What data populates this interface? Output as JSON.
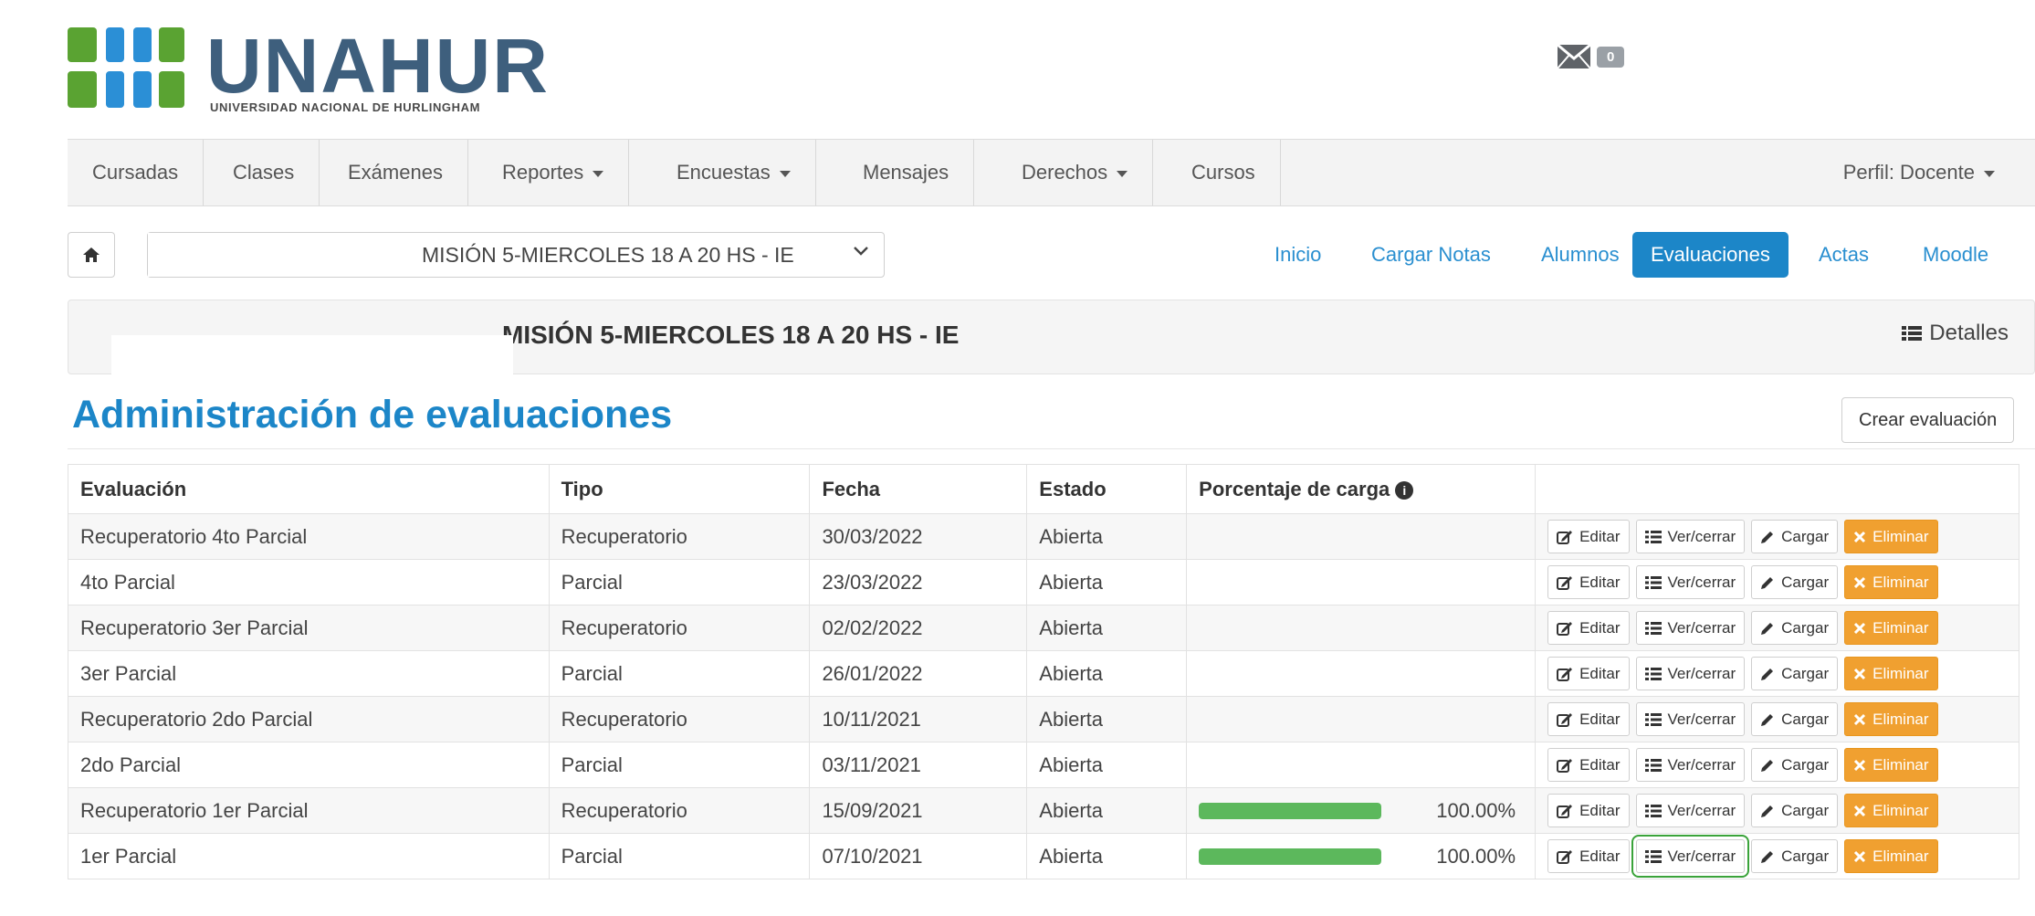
{
  "brand": {
    "title": "UNAHUR",
    "subtitle": "UNIVERSIDAD NACIONAL DE HURLINGHAM",
    "colors": {
      "green": "#5aa332",
      "blue": "#2b8fd6",
      "title": "#3e5f7d"
    }
  },
  "header": {
    "mail_icon": "envelope-icon",
    "unread_count": "0"
  },
  "nav": {
    "items": [
      {
        "label": "Cursadas",
        "dropdown": false
      },
      {
        "label": "Clases",
        "dropdown": false
      },
      {
        "label": "Exámenes",
        "dropdown": false
      },
      {
        "label": "Reportes",
        "dropdown": true
      },
      {
        "label": "Encuestas",
        "dropdown": true
      },
      {
        "label": "Mensajes",
        "dropdown": false
      },
      {
        "label": "Derechos",
        "dropdown": true
      },
      {
        "label": "Cursos",
        "dropdown": false
      }
    ],
    "profile": "Perfil: Docente"
  },
  "commission": {
    "selected": "MISIÓN 5-MIERCOLES 18 A 20 HS - IE",
    "title": "MISIÓN 5-MIERCOLES 18 A 20 HS - IE"
  },
  "pills": {
    "items": [
      {
        "label": "Inicio",
        "active": false
      },
      {
        "label": "Cargar Notas",
        "active": false
      },
      {
        "label": "Alumnos",
        "active": false
      },
      {
        "label": "Evaluaciones",
        "active": true
      },
      {
        "label": "Actas",
        "active": false
      },
      {
        "label": "Moodle",
        "active": false
      }
    ],
    "active_color": "#1c86c8"
  },
  "panel": {
    "details_label": "Detalles"
  },
  "page": {
    "title": "Administración de evaluaciones",
    "create_label": "Crear evaluación"
  },
  "table": {
    "headers": {
      "evaluacion": "Evaluación",
      "tipo": "Tipo",
      "fecha": "Fecha",
      "estado": "Estado",
      "porcentaje": "Porcentaje de carga"
    },
    "actions": {
      "edit": "Editar",
      "view": "Ver/cerrar",
      "load": "Cargar",
      "delete": "Eliminar"
    },
    "rows": [
      {
        "evaluacion": "Recuperatorio 4to Parcial",
        "tipo": "Recuperatorio",
        "fecha": "30/03/2022",
        "estado": "Abierta",
        "porcentaje": null
      },
      {
        "evaluacion": "4to Parcial",
        "tipo": "Parcial",
        "fecha": "23/03/2022",
        "estado": "Abierta",
        "porcentaje": null
      },
      {
        "evaluacion": "Recuperatorio 3er Parcial",
        "tipo": "Recuperatorio",
        "fecha": "02/02/2022",
        "estado": "Abierta",
        "porcentaje": null
      },
      {
        "evaluacion": "3er Parcial",
        "tipo": "Parcial",
        "fecha": "26/01/2022",
        "estado": "Abierta",
        "porcentaje": null
      },
      {
        "evaluacion": "Recuperatorio 2do Parcial",
        "tipo": "Recuperatorio",
        "fecha": "10/11/2021",
        "estado": "Abierta",
        "porcentaje": null
      },
      {
        "evaluacion": "2do Parcial",
        "tipo": "Parcial",
        "fecha": "03/11/2021",
        "estado": "Abierta",
        "porcentaje": null
      },
      {
        "evaluacion": "Recuperatorio 1er Parcial",
        "tipo": "Recuperatorio",
        "fecha": "15/09/2021",
        "estado": "Abierta",
        "porcentaje": "100.00%",
        "progress": 1.0
      },
      {
        "evaluacion": "1er Parcial",
        "tipo": "Parcial",
        "fecha": "07/10/2021",
        "estado": "Abierta",
        "porcentaje": "100.00%",
        "progress": 1.0,
        "highlight_view": true
      }
    ],
    "delete_color": "#f0a030",
    "progress_color": "#5cb85c"
  }
}
